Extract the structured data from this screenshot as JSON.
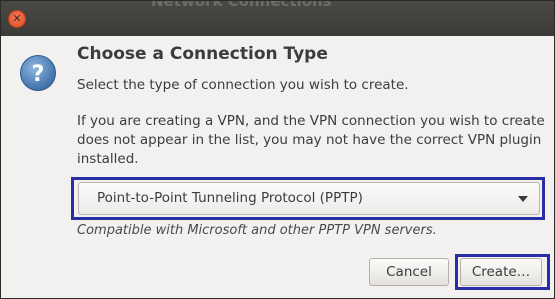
{
  "window": {
    "title": "Network Connections",
    "close_icon": "close-icon"
  },
  "dialog": {
    "icon": "question-icon",
    "heading": "Choose a Connection Type",
    "subtext": "Select the type of connection you wish to create.",
    "info": "If you are creating a VPN, and the VPN connection you wish to create does not appear in the list, you may not have the correct VPN plugin installed.",
    "connection_type": {
      "selected": "Point-to-Point Tunneling Protocol (PPTP)"
    },
    "note": "Compatible with Microsoft and other PPTP VPN servers.",
    "buttons": {
      "cancel": "Cancel",
      "create": "Create…"
    },
    "highlight_color": "#2a2ea6"
  }
}
